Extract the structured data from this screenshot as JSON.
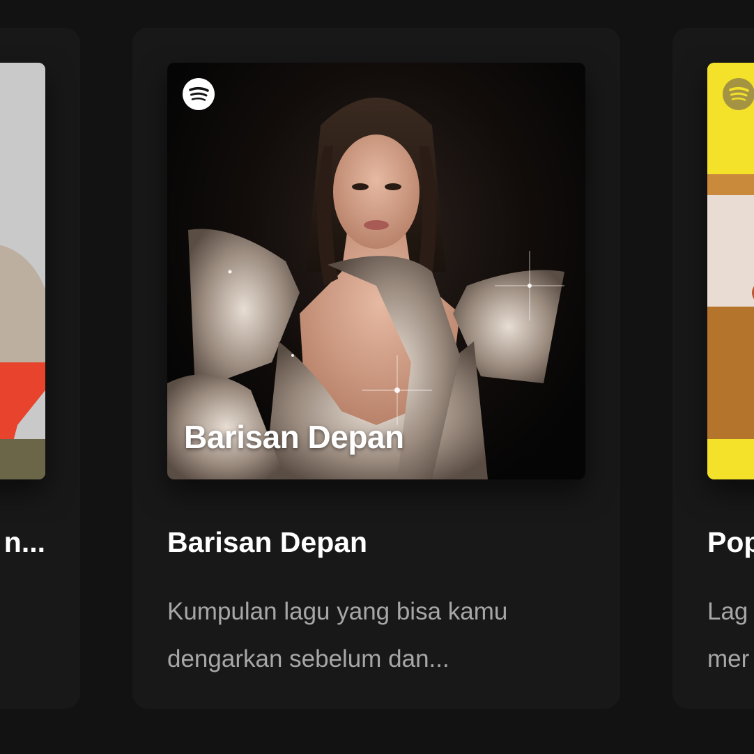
{
  "cards": [
    {
      "title": "n..."
    },
    {
      "cover_text": "Barisan Depan",
      "title": "Barisan Depan",
      "description_lines": [
        "Kumpulan lagu yang bisa kamu",
        "dengarkan sebelum dan..."
      ]
    },
    {
      "title": "Pop",
      "description_lines": [
        "Lag",
        "mer"
      ]
    }
  ],
  "icons": {
    "badge": "spotify-logo-icon"
  },
  "colors": {
    "background": "#121212",
    "card": "#181818",
    "title": "#ffffff",
    "description": "#a7a7a7",
    "accent_yellow": "#f3e12a"
  }
}
